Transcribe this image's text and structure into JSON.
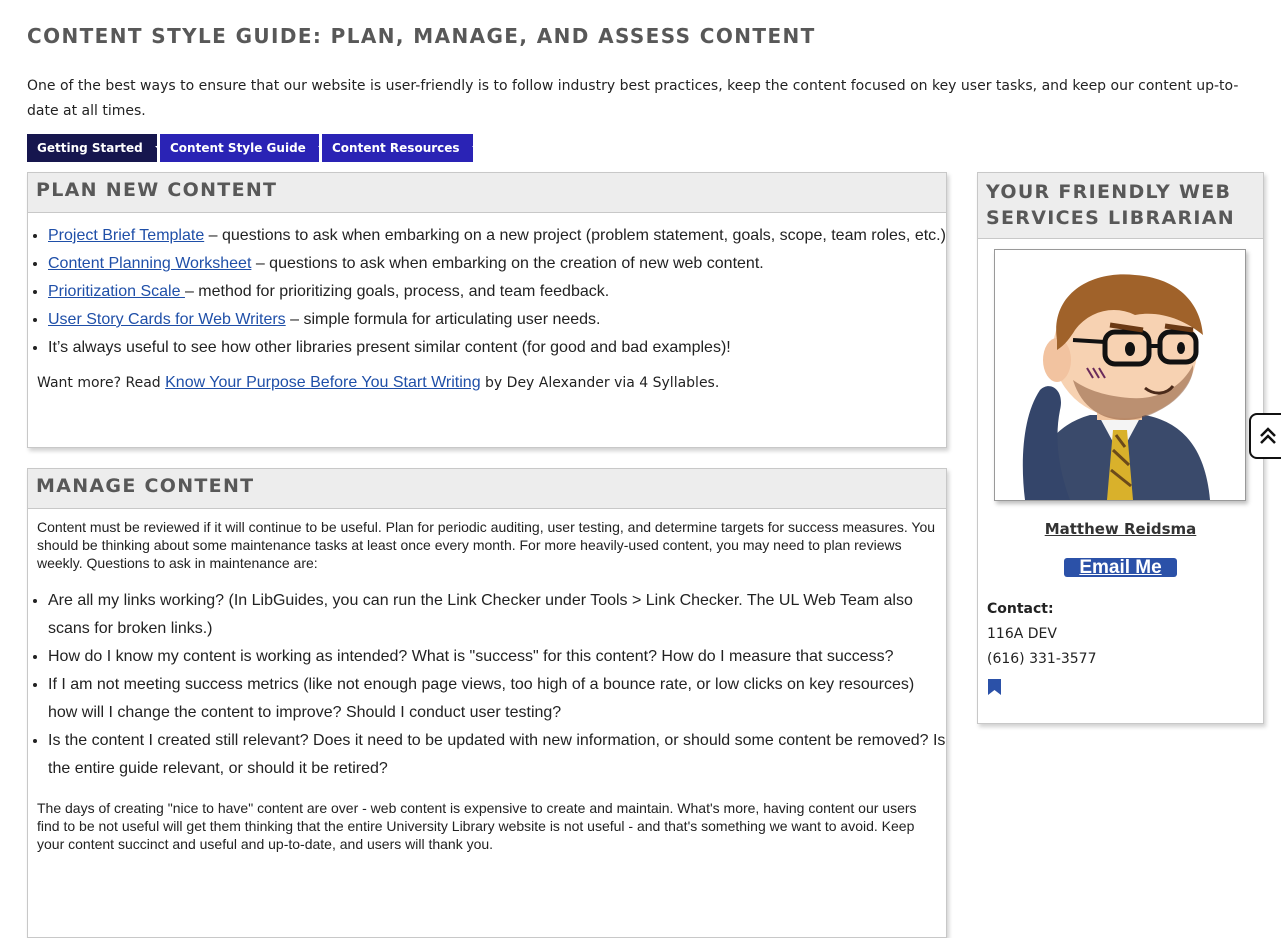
{
  "page": {
    "title": "CONTENT STYLE GUIDE: PLAN, MANAGE, AND ASSESS CONTENT",
    "intro": "One of the best ways to ensure that our website is user-friendly is to follow industry best practices, keep the content focused on key user tasks, and keep our content up-to-date at all times."
  },
  "nav": {
    "tabs": [
      {
        "label": "Getting Started",
        "active": true
      },
      {
        "label": "Content Style Guide",
        "active": false
      },
      {
        "label": "Content Resources",
        "active": false
      }
    ]
  },
  "plan": {
    "heading": "PLAN NEW CONTENT",
    "items": [
      {
        "link": "Project Brief Template",
        "text": " – questions to ask when embarking on a new project (problem statement, goals, scope, team roles, etc.)"
      },
      {
        "link": "Content Planning Worksheet",
        "text": " – questions to ask when embarking on the creation of new web content."
      },
      {
        "link": "Prioritization Scale ",
        "text": "– method for prioritizing goals, process, and team feedback."
      },
      {
        "link": "User Story Cards for Web Writers",
        "text": " – simple formula for articulating user needs."
      },
      {
        "link": "",
        "text": "It’s always useful to see how other libraries present similar content (for good and bad examples)!"
      }
    ],
    "note_prefix": "Want more? Read ",
    "note_link": "Know Your Purpose Before You Start Writing",
    "note_suffix": " by Dey Alexander via 4 Syllables."
  },
  "manage": {
    "heading": "MANAGE CONTENT",
    "intro": "Content must be reviewed if it will continue to be useful. Plan for periodic auditing, user testing, and determine targets for success measures. You should be thinking about some maintenance tasks at least once every month. For more heavily-used content, you may need to plan reviews weekly. Questions to ask in maintenance are:",
    "items": [
      "Are all my links working? (In LibGuides, you can run the Link Checker under Tools > Link Checker. The UL Web Team also scans for broken links.)",
      "How do I know my content is working as intended? What is \"success\" for this content? How do I measure that success?",
      "If I am not meeting success metrics (like not enough page views, too high of a bounce rate, or low clicks on key resources) how will I change the content to improve? Should I conduct user testing?",
      "Is the content I created still relevant? Does it need to be updated with new information, or should some content be removed? Is the entire guide relevant, or should it be retired?"
    ],
    "closing": "The days of creating \"nice to have\" content are over - web content is expensive to create and maintain. What's more, having content our users find to be not useful will get them thinking that the entire University Library website is not useful - and that's something we want to avoid. Keep your content succinct and useful and up-to-date, and users will thank you."
  },
  "librarian": {
    "heading": "YOUR FRIENDLY WEB SERVICES LIBRARIAN",
    "name": "Matthew Reidsma",
    "email_label": "Email Me",
    "contact_label": "Contact:",
    "office": "116A DEV",
    "phone": "(616) 331-3577"
  },
  "icons": {
    "bookmark": "bookmark-icon",
    "back_to_top": "chevron-up-double-icon"
  },
  "colors": {
    "nav_active": "#16164e",
    "nav_tab": "#2a23b5",
    "link": "#1f4fa8",
    "email_button": "#2b51a8"
  }
}
